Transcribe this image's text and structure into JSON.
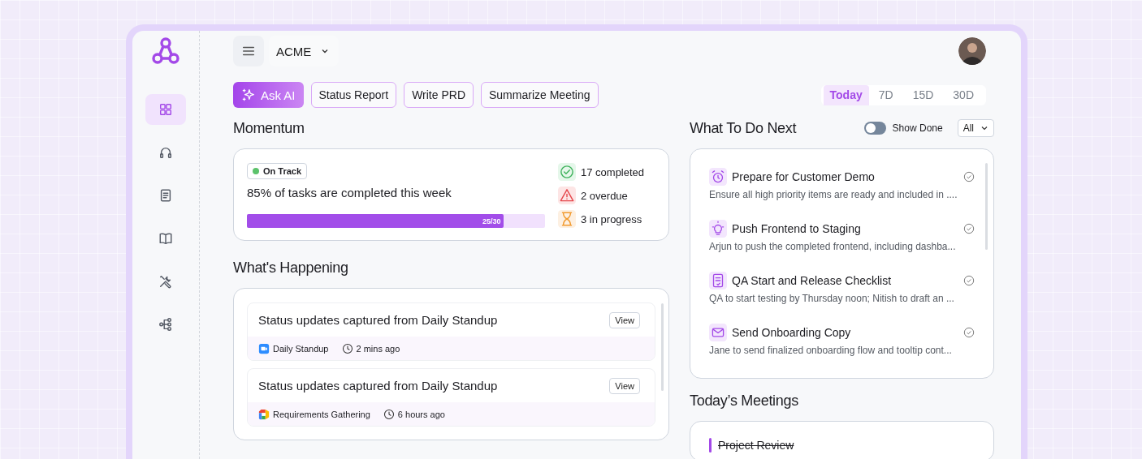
{
  "sidebar": {
    "items": [
      {
        "selected": true
      },
      {
        "selected": false
      },
      {
        "selected": false
      },
      {
        "selected": false
      },
      {
        "selected": false
      },
      {
        "selected": false
      }
    ]
  },
  "header": {
    "workspace": "ACME"
  },
  "actions": [
    {
      "label": "Ask AI",
      "kind": "primary"
    },
    {
      "label": "Status Report",
      "kind": "secondary"
    },
    {
      "label": "Write PRD",
      "kind": "secondary"
    },
    {
      "label": "Summarize Meeting",
      "kind": "secondary"
    }
  ],
  "periods": [
    {
      "label": "Today",
      "selected": true
    },
    {
      "label": "7D",
      "selected": false
    },
    {
      "label": "15D",
      "selected": false
    },
    {
      "label": "30D",
      "selected": false
    }
  ],
  "momentum": {
    "title": "Momentum",
    "status": "On Track",
    "summary": "85% of tasks are completed this week",
    "progress": {
      "level": 0.86,
      "label": "25/30"
    },
    "stats": [
      {
        "kind": "completed",
        "label": "17 completed"
      },
      {
        "kind": "overdue",
        "label": "2 overdue"
      },
      {
        "kind": "in_progress",
        "label": "3 in progress"
      }
    ]
  },
  "happening": {
    "title": "What's Happening",
    "items": [
      {
        "title": "Status updates captured from Daily Standup",
        "button": "View",
        "source": "Daily Standup",
        "time": "2 mins ago"
      },
      {
        "title": "Status updates captured from Daily Standup",
        "button": "View",
        "source": "Requirements Gathering",
        "time": "6 hours ago"
      }
    ]
  },
  "todo": {
    "title": "What To Do Next",
    "show_done": {
      "label": "Show Done",
      "on": false
    },
    "filter": "All",
    "items": [
      {
        "title": "Prepare for Customer Demo",
        "description": "Ensure all high priority items are ready and included in ...."
      },
      {
        "title": "Push Frontend to Staging",
        "description": "Arjun to push the completed frontend, including dashba..."
      },
      {
        "title": "QA Start and Release Checklist",
        "description": "QA to start testing by Thursday noon; Nitish to draft an ..."
      },
      {
        "title": "Send Onboarding Copy",
        "description": "Jane to send finalized onboarding flow and tooltip cont..."
      }
    ]
  },
  "meetings": {
    "title": "Today’s Meetings",
    "items": [
      {
        "title": "Project Review",
        "done": true
      }
    ]
  }
}
